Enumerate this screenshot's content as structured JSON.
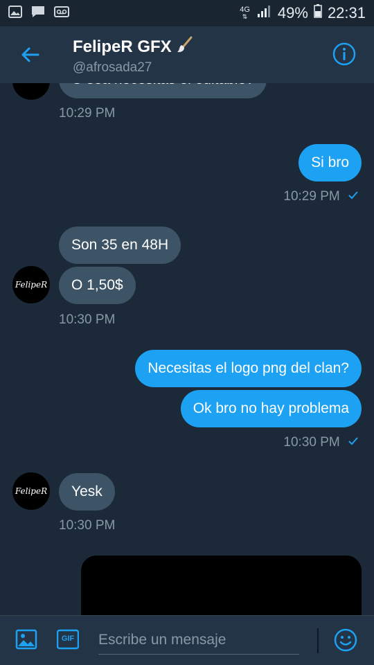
{
  "status_bar": {
    "network": "4G",
    "battery": "49%",
    "time": "22:31",
    "icons": [
      "image-icon",
      "chat-icon",
      "voicemail-icon",
      "signal-icon",
      "battery-icon"
    ]
  },
  "header": {
    "name": "FelipeR GFX",
    "emoji": "paintbrush-icon",
    "handle": "@afrosada27",
    "back_icon": "back-arrow-icon",
    "info_icon": "info-icon"
  },
  "conversation": {
    "partial_message": "O sea necesitas el editable?",
    "messages": [
      {
        "side": "in",
        "text": "O sea necesitas el editable?",
        "time": "10:29 PM"
      },
      {
        "side": "out",
        "text": "Si bro",
        "time": "10:29 PM",
        "read": true
      },
      {
        "side": "in",
        "text": "Son 35 en 48H"
      },
      {
        "side": "in",
        "text": "O 1,50$",
        "time": "10:30 PM"
      },
      {
        "side": "out",
        "text": "Necesitas el logo png del clan?"
      },
      {
        "side": "out",
        "text": "Ok bro no hay problema",
        "time": "10:30 PM",
        "read": true
      },
      {
        "side": "in",
        "text": "Yesk",
        "time": "10:30 PM"
      }
    ],
    "avatar_label": "FelipeR"
  },
  "composer": {
    "placeholder": "Escribe un mensaje",
    "gif_label": "GIF",
    "image_icon": "image-icon",
    "emoji_icon": "emoji-icon"
  },
  "colors": {
    "background": "#1c2938",
    "header": "#243447",
    "incoming": "#3d5466",
    "outgoing": "#1da1f2",
    "accent": "#1da1f2",
    "muted": "#8899a6"
  }
}
